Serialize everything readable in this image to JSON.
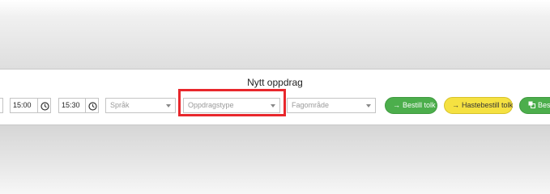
{
  "modal": {
    "title": "Nytt oppdrag"
  },
  "form": {
    "start_time": "15:00",
    "end_time": "15:30",
    "language_placeholder": "Språk",
    "assignment_type_placeholder": "Oppdragstype",
    "subject_area_placeholder": "Fagområde"
  },
  "buttons": {
    "order_interpreter": "Bestill tolk",
    "urgent_order": "Hastebestill tolk",
    "third_partial": "Best"
  },
  "icons": {
    "arrow": "arrow-right-icon",
    "clock": "clock-icon",
    "translate": "translate-icon"
  },
  "colors": {
    "accent_green": "#4cae4c",
    "accent_yellow": "#f5e141",
    "highlight_red": "#e8272c"
  }
}
